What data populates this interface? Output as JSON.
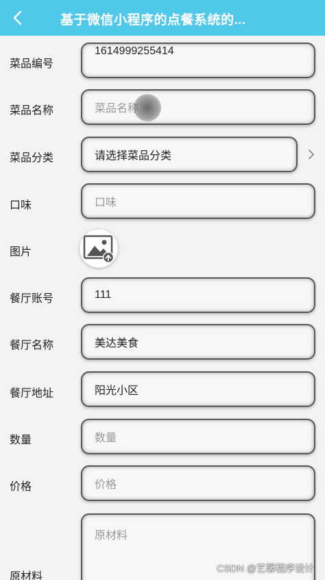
{
  "navbar": {
    "back_icon": "chevron-left-icon",
    "title": "基于微信小程序的点餐系统的..."
  },
  "form": {
    "dish_no": {
      "label": "菜品编号",
      "value": "1614999255414"
    },
    "dish_name": {
      "label": "菜品名称",
      "placeholder": "菜品名称"
    },
    "dish_category": {
      "label": "菜品分类",
      "value": "请选择菜品分类",
      "icon": "chevron-right-icon"
    },
    "taste": {
      "label": "口味",
      "placeholder": "口味"
    },
    "image": {
      "label": "图片",
      "icon": "image-upload-icon"
    },
    "restaurant_account": {
      "label": "餐厅账号",
      "value": "111"
    },
    "restaurant_name": {
      "label": "餐厅名称",
      "value": "美达美食"
    },
    "restaurant_address": {
      "label": "餐厅地址",
      "value": "阳光小区"
    },
    "quantity": {
      "label": "数量",
      "placeholder": "数量"
    },
    "price": {
      "label": "价格",
      "placeholder": "价格"
    },
    "ingredients": {
      "label": "原材料",
      "placeholder": "原材料"
    }
  },
  "watermark": "CSDN @艺馨程序设计",
  "colors": {
    "navbar": "#4fc8ea",
    "background": "#f3f3f3"
  }
}
